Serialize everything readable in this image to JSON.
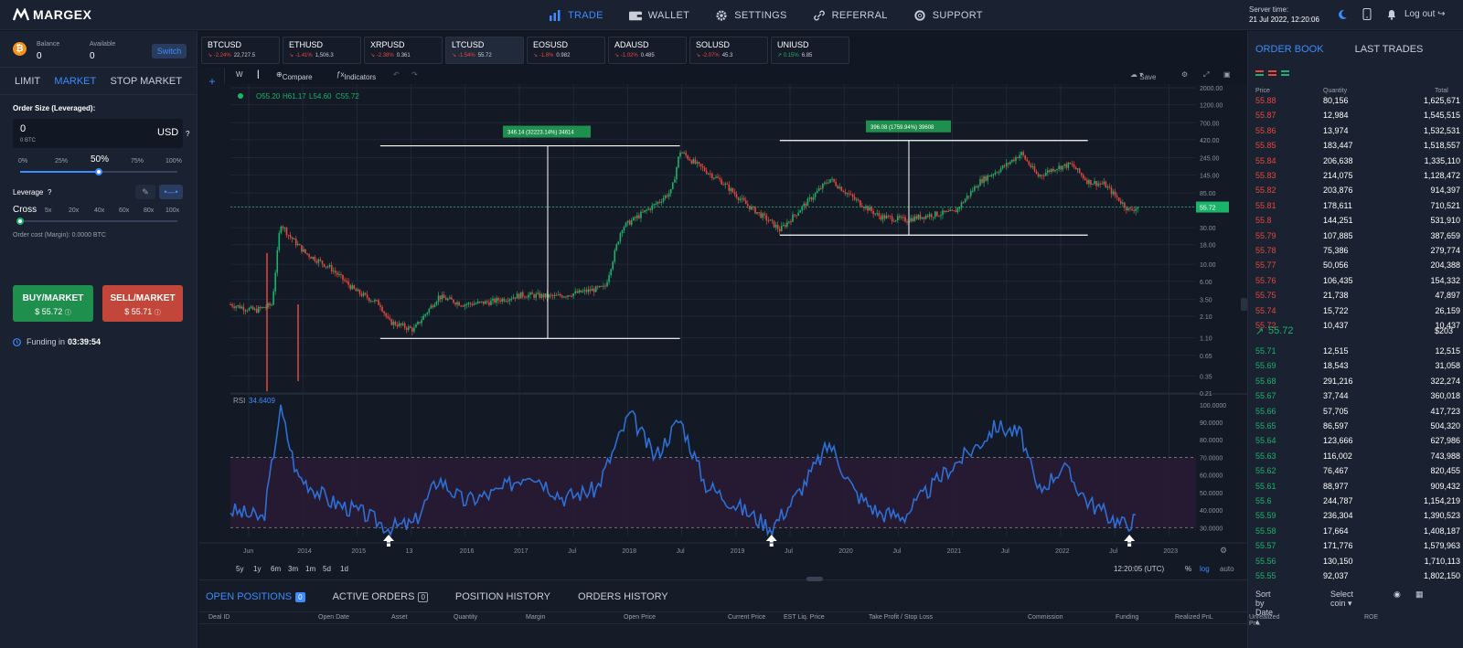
{
  "app": {
    "name": "MARGEX"
  },
  "nav": [
    {
      "label": "TRADE",
      "active": true,
      "icon": "bar-chart-icon"
    },
    {
      "label": "WALLET",
      "active": false,
      "icon": "wallet-icon"
    },
    {
      "label": "SETTINGS",
      "active": false,
      "icon": "gear-icon"
    },
    {
      "label": "REFERRAL",
      "active": false,
      "icon": "link-icon"
    },
    {
      "label": "SUPPORT",
      "active": false,
      "icon": "lifebuoy-icon"
    }
  ],
  "server": {
    "label": "Server time:",
    "time": "21 Jul 2022, 12:20:06"
  },
  "logout": "Log out",
  "balance": {
    "balance_label": "Balance",
    "balance": "0",
    "available_label": "Available",
    "available": "0",
    "switch": "Switch"
  },
  "order_tabs": [
    "LIMIT",
    "MARKET",
    "STOP MARKET"
  ],
  "order": {
    "size_label": "Order Size (Leveraged):",
    "size_value": "0",
    "size_sub": "0 BTC",
    "currency": "USD",
    "pcts": [
      "0%",
      "25%",
      "50%",
      "75%",
      "100%"
    ],
    "pct_value": 0.5,
    "leverage_label": "Leverage",
    "cross": "Cross",
    "levs": [
      "5x",
      "20x",
      "40x",
      "60x",
      "80x",
      "100x"
    ],
    "cost": "Order cost (Margin): 0.0000 BTC",
    "buy_label": "BUY/MARKET",
    "buy_price": "$ 55.72",
    "sell_label": "SELL/MARKET",
    "sell_price": "$ 55.71",
    "funding_label": "Funding in",
    "funding_time": "03:39:54"
  },
  "tickers": [
    {
      "sym": "BTCUSD",
      "chg": "-2.24%",
      "price": "22,727.5",
      "neg": true
    },
    {
      "sym": "ETHUSD",
      "chg": "-1.41%",
      "price": "1,506.3",
      "neg": true
    },
    {
      "sym": "XRPUSD",
      "chg": "-2.38%",
      "price": "0.361",
      "neg": true
    },
    {
      "sym": "LTCUSD",
      "chg": "-1.54%",
      "price": "55.72",
      "neg": true,
      "active": true
    },
    {
      "sym": "EOSUSD",
      "chg": "-1.8%",
      "price": "0.982",
      "neg": true
    },
    {
      "sym": "ADAUSD",
      "chg": "-1.02%",
      "price": "0.485",
      "neg": true
    },
    {
      "sym": "SOLUSD",
      "chg": "-2.07%",
      "price": "45.3",
      "neg": true
    },
    {
      "sym": "UNIUSD",
      "chg": "0.15%",
      "price": "6.85",
      "neg": false
    }
  ],
  "chart_toolbar": {
    "interval": "W",
    "compare": "Compare",
    "indicators": "Indicators",
    "save": "Save"
  },
  "chart_data": {
    "type": "candlestick",
    "symbol": "LTCUSD",
    "ohlc_label": {
      "o": "O55.20",
      "h": "H61.17",
      "l": "L54.60",
      "c": "C55.72"
    },
    "y_scale": "log",
    "y_ticks": [
      "2000.00",
      "1200.00",
      "700.00",
      "420.00",
      "245.00",
      "145.00",
      "85.00",
      "55.72",
      "30.00",
      "18.00",
      "10.00",
      "6.00",
      "3.50",
      "2.10",
      "1.10",
      "0.65",
      "0.35",
      "0.21"
    ],
    "x_ticks": [
      "Jun",
      "2014",
      "2015",
      "13",
      "2016",
      "2017",
      "Jul",
      "2018",
      "Jul",
      "2019",
      "Jul",
      "2020",
      "Jul",
      "2021",
      "Jul",
      "2022",
      "Jul",
      "2023"
    ],
    "last_price": "55.72",
    "measure_labels": [
      "346.14 (32223.14%) 34614",
      "396.08 (1759.94%) 39608"
    ],
    "close_path": [
      [
        "2013-06",
        3.0
      ],
      [
        "2013-09",
        2.5
      ],
      [
        "2013-11",
        3.0
      ],
      [
        "2013-12",
        35
      ],
      [
        "2014-01",
        24
      ],
      [
        "2014-03",
        14
      ],
      [
        "2014-06",
        9
      ],
      [
        "2014-09",
        4.5
      ],
      [
        "2014-12",
        3.0
      ],
      [
        "2015-01",
        1.8
      ],
      [
        "2015-04",
        1.4
      ],
      [
        "2015-07",
        3.8
      ],
      [
        "2015-10",
        3.0
      ],
      [
        "2016-01",
        3.2
      ],
      [
        "2016-05",
        4.0
      ],
      [
        "2016-09",
        3.8
      ],
      [
        "2016-12",
        4.3
      ],
      [
        "2017-03",
        5.0
      ],
      [
        "2017-05",
        30
      ],
      [
        "2017-09",
        60
      ],
      [
        "2017-11",
        90
      ],
      [
        "2017-12",
        300
      ],
      [
        "2018-02",
        200
      ],
      [
        "2018-05",
        120
      ],
      [
        "2018-08",
        60
      ],
      [
        "2018-11",
        35
      ],
      [
        "2018-12",
        28
      ],
      [
        "2019-03",
        60
      ],
      [
        "2019-06",
        130
      ],
      [
        "2019-09",
        70
      ],
      [
        "2019-12",
        42
      ],
      [
        "2020-03",
        38
      ],
      [
        "2020-06",
        44
      ],
      [
        "2020-09",
        48
      ],
      [
        "2020-12",
        120
      ],
      [
        "2021-03",
        190
      ],
      [
        "2021-05",
        280
      ],
      [
        "2021-07",
        140
      ],
      [
        "2021-09",
        180
      ],
      [
        "2021-11",
        200
      ],
      [
        "2022-01",
        120
      ],
      [
        "2022-03",
        110
      ],
      [
        "2022-05",
        65
      ],
      [
        "2022-06",
        50
      ],
      [
        "2022-07",
        55.72
      ]
    ],
    "rsi": {
      "label": "RSI",
      "value": "34.6409",
      "ticks": [
        "100.0000",
        "90.0000",
        "80.0000",
        "70.0000",
        "60.0000",
        "50.0000",
        "40.0000",
        "30.0000"
      ],
      "band": [
        30,
        70
      ],
      "path": [
        [
          "2013-06",
          40
        ],
        [
          "2013-10",
          35
        ],
        [
          "2013-12",
          98
        ],
        [
          "2014-02",
          60
        ],
        [
          "2014-06",
          45
        ],
        [
          "2014-10",
          38
        ],
        [
          "2015-01",
          30
        ],
        [
          "2015-04",
          32
        ],
        [
          "2015-07",
          58
        ],
        [
          "2015-10",
          45
        ],
        [
          "2016-02",
          50
        ],
        [
          "2016-06",
          62
        ],
        [
          "2016-10",
          47
        ],
        [
          "2017-02",
          52
        ],
        [
          "2017-06",
          95
        ],
        [
          "2017-09",
          70
        ],
        [
          "2017-12",
          92
        ],
        [
          "2018-03",
          55
        ],
        [
          "2018-07",
          42
        ],
        [
          "2018-11",
          30
        ],
        [
          "2019-02",
          48
        ],
        [
          "2019-06",
          78
        ],
        [
          "2019-09",
          50
        ],
        [
          "2019-12",
          38
        ],
        [
          "2020-03",
          37
        ],
        [
          "2020-08",
          62
        ],
        [
          "2020-12",
          78
        ],
        [
          "2021-02",
          88
        ],
        [
          "2021-05",
          83
        ],
        [
          "2021-07",
          50
        ],
        [
          "2021-10",
          65
        ],
        [
          "2022-01",
          45
        ],
        [
          "2022-05",
          32
        ],
        [
          "2022-07",
          34.64
        ]
      ]
    }
  },
  "timeframes": [
    "5y",
    "1y",
    "6m",
    "3m",
    "1m",
    "5d",
    "1d"
  ],
  "chart_footer": {
    "clock": "12:20:05 (UTC)",
    "pct": "%",
    "log": "log",
    "auto": "auto"
  },
  "orderbook": {
    "tabs": [
      "ORDER BOOK",
      "LAST TRADES"
    ],
    "headers": [
      "Price",
      "Quantity",
      "Total"
    ],
    "asks": [
      [
        "55.88",
        "80,156",
        "1,625,671"
      ],
      [
        "55.87",
        "12,984",
        "1,545,515"
      ],
      [
        "55.86",
        "13,974",
        "1,532,531"
      ],
      [
        "55.85",
        "183,447",
        "1,518,557"
      ],
      [
        "55.84",
        "206,638",
        "1,335,110"
      ],
      [
        "55.83",
        "214,075",
        "1,128,472"
      ],
      [
        "55.82",
        "203,876",
        "914,397"
      ],
      [
        "55.81",
        "178,611",
        "710,521"
      ],
      [
        "55.8",
        "144,251",
        "531,910"
      ],
      [
        "55.79",
        "107,885",
        "387,659"
      ],
      [
        "55.78",
        "75,386",
        "279,774"
      ],
      [
        "55.77",
        "50,056",
        "204,388"
      ],
      [
        "55.76",
        "106,435",
        "154,332"
      ],
      [
        "55.75",
        "21,738",
        "47,897"
      ],
      [
        "55.74",
        "15,722",
        "26,159"
      ],
      [
        "55.72",
        "10,437",
        "10,437"
      ]
    ],
    "mid_price": "55.72",
    "mid_usd": "$203",
    "bids": [
      [
        "55.71",
        "12,515",
        "12,515"
      ],
      [
        "55.69",
        "18,543",
        "31,058"
      ],
      [
        "55.68",
        "291,216",
        "322,274"
      ],
      [
        "55.67",
        "37,744",
        "360,018"
      ],
      [
        "55.66",
        "57,705",
        "417,723"
      ],
      [
        "55.65",
        "86,597",
        "504,320"
      ],
      [
        "55.64",
        "123,666",
        "627,986"
      ],
      [
        "55.63",
        "116,002",
        "743,988"
      ],
      [
        "55.62",
        "76,467",
        "820,455"
      ],
      [
        "55.61",
        "88,977",
        "909,432"
      ],
      [
        "55.6",
        "244,787",
        "1,154,219"
      ],
      [
        "55.59",
        "236,304",
        "1,390,523"
      ],
      [
        "55.58",
        "17,664",
        "1,408,187"
      ],
      [
        "55.57",
        "171,776",
        "1,579,963"
      ],
      [
        "55.56",
        "130,150",
        "1,710,113"
      ],
      [
        "55.55",
        "92,037",
        "1,802,150"
      ]
    ]
  },
  "bottom": {
    "tabs": [
      {
        "label": "OPEN POSITIONS",
        "count": "0",
        "active": true
      },
      {
        "label": "ACTIVE ORDERS",
        "count": "0",
        "active": false
      },
      {
        "label": "POSITION HISTORY",
        "active": false
      },
      {
        "label": "ORDERS HISTORY",
        "active": false
      }
    ],
    "sort": "Sort by Date",
    "select_coin": "Select coin",
    "columns": [
      "Deal ID",
      "Open Date",
      "Asset",
      "Quantity",
      "Margin",
      "Open Price",
      "Current Price",
      "EST Liq. Price",
      "Take Profit / Stop Loss",
      "Commission",
      "Funding",
      "Realized PnL",
      "Unrealized PnL",
      "ROE"
    ]
  },
  "colors": {
    "accent": "#3d8bff",
    "up": "#1bb36a",
    "down": "#e5483d",
    "rsi": "#2e6fd6",
    "buy_btn": "#1f8f4e",
    "sell_btn": "#c2473a"
  }
}
